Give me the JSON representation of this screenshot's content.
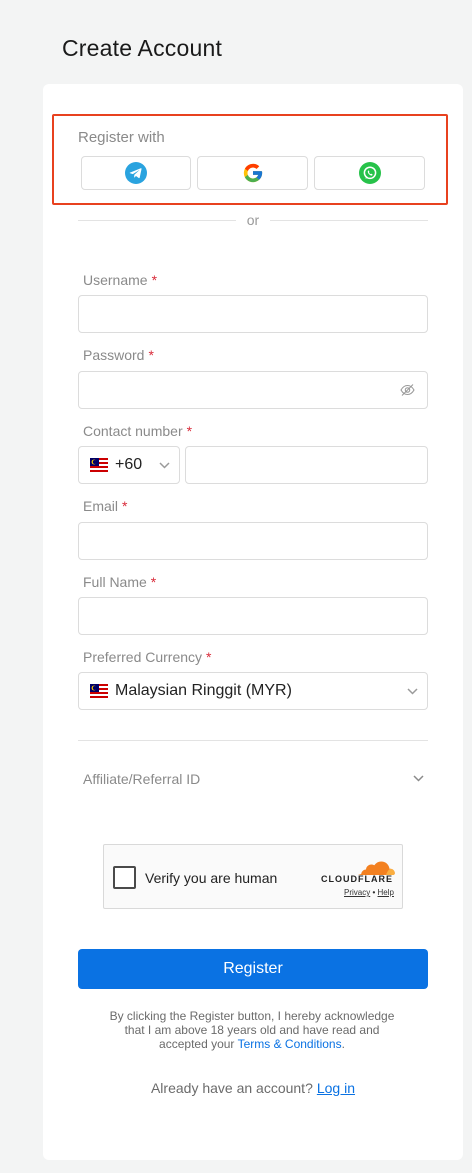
{
  "page": {
    "title": "Create Account"
  },
  "social": {
    "label": "Register with",
    "buttons": [
      {
        "name": "telegram",
        "icon": "telegram-icon",
        "color": "#2aa3df"
      },
      {
        "name": "google",
        "icon": "google-icon"
      },
      {
        "name": "whatsapp",
        "icon": "whatsapp-icon",
        "color": "#27c24a"
      }
    ],
    "or_text": "or"
  },
  "form": {
    "username": {
      "label": "Username",
      "required": "*",
      "value": ""
    },
    "password": {
      "label": "Password",
      "required": "*",
      "value": "",
      "icon": "eye-off-icon"
    },
    "contact": {
      "label": "Contact number",
      "required": "*",
      "country_code": "+60",
      "flag": "malaysia-flag-icon",
      "value": ""
    },
    "email": {
      "label": "Email",
      "required": "*",
      "value": ""
    },
    "full_name": {
      "label": "Full Name",
      "required": "*",
      "value": ""
    },
    "currency": {
      "label": "Preferred Currency",
      "required": "*",
      "selected": "Malaysian Ringgit (MYR)",
      "flag": "malaysia-flag-icon"
    },
    "affiliate": {
      "label": "Affiliate/Referral ID"
    }
  },
  "captcha": {
    "text": "Verify you are human",
    "brand": "CLOUDFLARE",
    "privacy": "Privacy",
    "separator": "•",
    "help": "Help",
    "brand_color": "#f38020"
  },
  "actions": {
    "register": "Register",
    "disclaimer": "By clicking the Register button, I hereby acknowledge that I am above 18 years old and have read and accepted your",
    "terms": "Terms & Conditions",
    "terms_suffix": ".",
    "already": "Already have an account?",
    "login": "Log in"
  },
  "colors": {
    "primary": "#0a72e3",
    "required": "#d92b3a",
    "highlight": "#e8411f"
  }
}
